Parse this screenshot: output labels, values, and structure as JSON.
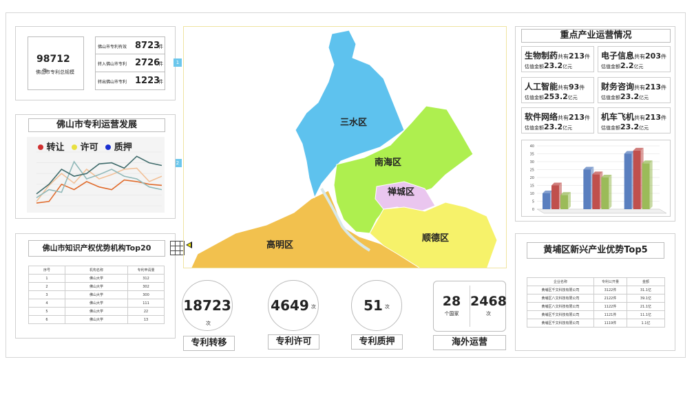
{
  "total": {
    "value": "98712",
    "unit": "件",
    "label": "佛山市专利总规模"
  },
  "stats": [
    {
      "label": "佛山市专利有效",
      "value": "8723",
      "unit": "件"
    },
    {
      "label": "转入佛山市专利",
      "value": "2726",
      "unit": "件"
    },
    {
      "label": "转出佛山市专利",
      "value": "1223",
      "unit": "件"
    }
  ],
  "markers": [
    "1",
    "2"
  ],
  "trend": {
    "title": "佛山市专利运营发展",
    "legend": [
      {
        "name": "转让",
        "color": "#d03030"
      },
      {
        "name": "许可",
        "color": "#e8e040"
      },
      {
        "name": "质押",
        "color": "#1a2fd0"
      }
    ]
  },
  "chart_data": [
    {
      "type": "line",
      "title": "佛山市专利运营发展",
      "x": [
        1,
        2,
        3,
        4,
        5,
        6,
        7,
        8,
        9,
        10,
        11
      ],
      "ylim": [
        0,
        100
      ],
      "series": [
        {
          "color": "#e06a2a",
          "values": [
            5,
            8,
            40,
            30,
            45,
            35,
            30,
            48,
            45,
            40,
            38
          ]
        },
        {
          "color": "#f2c097",
          "values": [
            8,
            38,
            60,
            42,
            68,
            50,
            58,
            68,
            70,
            45,
            55
          ]
        },
        {
          "color": "#8fb8b8",
          "values": [
            15,
            30,
            25,
            82,
            50,
            58,
            68,
            55,
            50,
            35,
            30
          ]
        },
        {
          "color": "#3f6b6b",
          "values": [
            22,
            40,
            68,
            55,
            60,
            78,
            80,
            70,
            92,
            80,
            75
          ]
        }
      ]
    },
    {
      "type": "bar",
      "categories": [
        "A",
        "B",
        "C"
      ],
      "ylim": [
        0,
        40
      ],
      "series": [
        {
          "color": "#5a7fbf",
          "values": [
            10,
            25,
            35
          ]
        },
        {
          "color": "#c0504d",
          "values": [
            15,
            22,
            37
          ]
        },
        {
          "color": "#9bbb59",
          "values": [
            9,
            20,
            29
          ]
        }
      ]
    }
  ],
  "top20": {
    "title": "佛山市知识产权优势机构Top20",
    "headers": [
      "序号",
      "机构名称",
      "专利申请量"
    ],
    "rows": [
      [
        "1",
        "佛山大学",
        "312"
      ],
      [
        "2",
        "佛山大学",
        "302"
      ],
      [
        "3",
        "佛山大学",
        "300"
      ],
      [
        "4",
        "佛山大学",
        "111"
      ],
      [
        "5",
        "佛山大学",
        "22"
      ],
      [
        "6",
        "佛山大学",
        "13"
      ]
    ]
  },
  "map": {
    "districts": [
      "三水区",
      "南海区",
      "禅城区",
      "高明区",
      "顺德区"
    ]
  },
  "kpis": [
    {
      "value": "18723",
      "unit": "次",
      "caption": "专利转移"
    },
    {
      "value": "4649",
      "unit": "次",
      "caption": "专利许可"
    },
    {
      "value": "51",
      "unit": "次",
      "caption": "专利质押"
    }
  ],
  "overseas": {
    "countries": "28",
    "countries_label": "个国家",
    "times": "2468",
    "times_label": "次",
    "caption": "海外运营"
  },
  "industry": {
    "title": "重点产业运营情况",
    "items": [
      {
        "name": "生物制药",
        "count_prefix": "共有",
        "count": "213",
        "count_unit": "件",
        "value_prefix": "估值金额",
        "value": "23.2",
        "value_unit": "亿元"
      },
      {
        "name": "电子信息",
        "count_prefix": "共有",
        "count": "203",
        "count_unit": "件",
        "value_prefix": "估值金额",
        "value": "2.2",
        "value_unit": "亿元"
      },
      {
        "name": "人工智能",
        "count_prefix": "共有",
        "count": "93",
        "count_unit": "件",
        "value_prefix": "估值金额",
        "value": "253.2",
        "value_unit": "亿元"
      },
      {
        "name": "财务咨询",
        "count_prefix": "共有",
        "count": "213",
        "count_unit": "件",
        "value_prefix": "估值金额",
        "value": "23.2",
        "value_unit": "亿元"
      },
      {
        "name": "软件网络",
        "count_prefix": "共有",
        "count": "213",
        "count_unit": "件",
        "value_prefix": "估值金额",
        "value": "23.2",
        "value_unit": "亿元"
      },
      {
        "name": "机车飞机",
        "count_prefix": "共有",
        "count": "213",
        "count_unit": "件",
        "value_prefix": "估值金额",
        "value": "23.2",
        "value_unit": "亿元"
      }
    ],
    "bar_axis": [
      "40",
      "35",
      "30",
      "25",
      "20",
      "15",
      "10",
      "5",
      "0"
    ]
  },
  "huangpu": {
    "title": "黄埔区新兴产业优势Top5",
    "headers": [
      "企业名称",
      "专利公开量",
      "金额"
    ],
    "rows": [
      [
        "黄埔区千文科技有限公司",
        "3122件",
        "31.1亿"
      ],
      [
        "黄埔区八文科技有限公司",
        "2122件",
        "39.1亿"
      ],
      [
        "黄埔区八文科技有限公司",
        "1122件",
        "21.1亿"
      ],
      [
        "黄埔区千文科技有限公司",
        "1121件",
        "11.1亿"
      ],
      [
        "黄埔区千文科技有限公司",
        "1119件",
        "1.1亿"
      ]
    ]
  }
}
